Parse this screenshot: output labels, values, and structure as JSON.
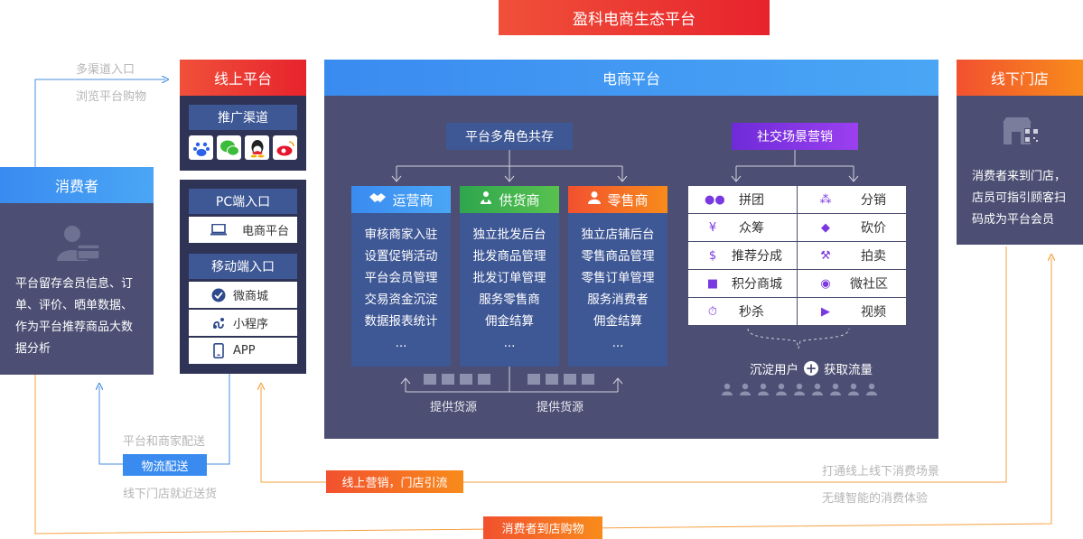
{
  "title": "盈科电商生态平台",
  "consumer": {
    "title": "消费者",
    "text": "平台留存会员信息、订单、评价、晒单数据、作为平台推荐商品大数据分析"
  },
  "channels_top": [
    "多渠道入口",
    "浏览平台购物"
  ],
  "online": {
    "title": "线上平台",
    "promo_title": "推广渠道",
    "promo_icons": [
      "baidu-icon",
      "wechat-icon",
      "qq-icon",
      "weibo-icon"
    ],
    "pc_title": "PC端入口",
    "pc_item": "电商平台",
    "mobile_title": "移动端入口",
    "mobile_items": [
      "微商城",
      "小程序",
      "APP"
    ]
  },
  "ecommerce": {
    "title": "电商平台",
    "roles_title": "平台多角色共存",
    "roles": [
      {
        "name": "运营商",
        "icon": "handshake-icon",
        "items": [
          "审核商家入驻",
          "设置促销活动",
          "平台会员管理",
          "交易资金沉淀",
          "数据报表统计",
          "..."
        ]
      },
      {
        "name": "供货商",
        "icon": "supplier-icon",
        "items": [
          "独立批发后台",
          "批发商品管理",
          "批发订单管理",
          "服务零售商",
          "佣金结算",
          "..."
        ]
      },
      {
        "name": "零售商",
        "icon": "retailer-icon",
        "items": [
          "独立店铺后台",
          "零售商品管理",
          "零售订单管理",
          "服务消费者",
          "佣金结算",
          "..."
        ]
      }
    ],
    "supply_labels": [
      "提供货源",
      "提供货源"
    ],
    "social_title": "社交场景营销",
    "social_items": [
      {
        "label": "拼团",
        "icon": "group-icon"
      },
      {
        "label": "分销",
        "icon": "distribution-icon"
      },
      {
        "label": "众筹",
        "icon": "crowdfunding-icon"
      },
      {
        "label": "砍价",
        "icon": "bargain-icon"
      },
      {
        "label": "推荐分成",
        "icon": "referral-icon"
      },
      {
        "label": "拍卖",
        "icon": "auction-icon"
      },
      {
        "label": "积分商城",
        "icon": "gift-icon"
      },
      {
        "label": "微社区",
        "icon": "community-icon"
      },
      {
        "label": "秒杀",
        "icon": "flash-sale-icon"
      },
      {
        "label": "视频",
        "icon": "video-icon"
      }
    ],
    "flow_left": "沉淀用户",
    "flow_right": "获取流量"
  },
  "offline": {
    "title": "线下门店",
    "text": "消费者来到门店，店员可指引顾客扫码成为平台会员"
  },
  "logistics": {
    "top_label": "平台和商家配送",
    "badge": "物流配送",
    "bottom_label": "线下门店就近送货"
  },
  "marketing_badge": "线上营销，门店引流",
  "offline_labels": [
    "打通线上线下消费场景",
    "无缝智能的消费体验"
  ],
  "store_badge": "消费者到店购物",
  "colors": {
    "panel": "#4c4f73",
    "role_body": "#3e5795",
    "accent_orange": "#f88b1b",
    "accent_blue": "#3a8bf0",
    "line_blue": "#4a8fe0",
    "line_orange": "#f6a040"
  }
}
